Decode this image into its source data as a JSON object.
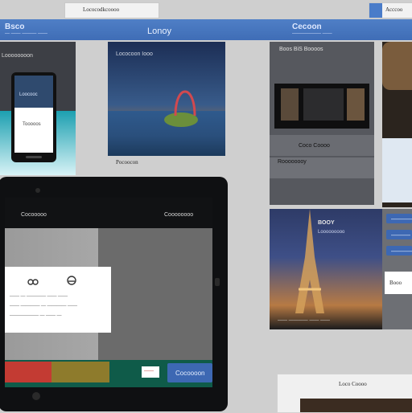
{
  "top": {
    "left_tab_text": "Lococodkcoooo",
    "right_tab_text": "Acccoo"
  },
  "header": {
    "left_label": "Bsco",
    "left_sub": "— —— ——— ——",
    "center_label": "Lonoy",
    "right_label": "Cecoon",
    "right_sub": "—————— ——"
  },
  "left_panel": {
    "title": "Loooooooon",
    "phone": {
      "headline": "Loocooc",
      "subline": "Tooooos"
    }
  },
  "hero_card": {
    "title": "Lococoon Iooo",
    "caption": "Pocoocon"
  },
  "right_stack": {
    "video_title": "Boos BiS Boooos",
    "caption_1": "Coco Coooo",
    "caption_2": "Roooooooy"
  },
  "tablet": {
    "brand": "Cocooooo",
    "nav_label": "Coooooooo",
    "card_lines": [
      "—— — ———— —— ——",
      "—— ———— — ———— ——",
      "—————— — —— —"
    ],
    "cta_primary": "Cocoooon",
    "cta_secondary": "——"
  },
  "eiffel_card": {
    "title": "BOOY",
    "subtitle": "Looooooooo",
    "caption": "—— ———— —— ——"
  },
  "side_buttons": {
    "b1": "————",
    "b2": "———",
    "b3": "————",
    "b4": "Booo"
  },
  "bottom_card": {
    "title": "Loco Coooo"
  }
}
